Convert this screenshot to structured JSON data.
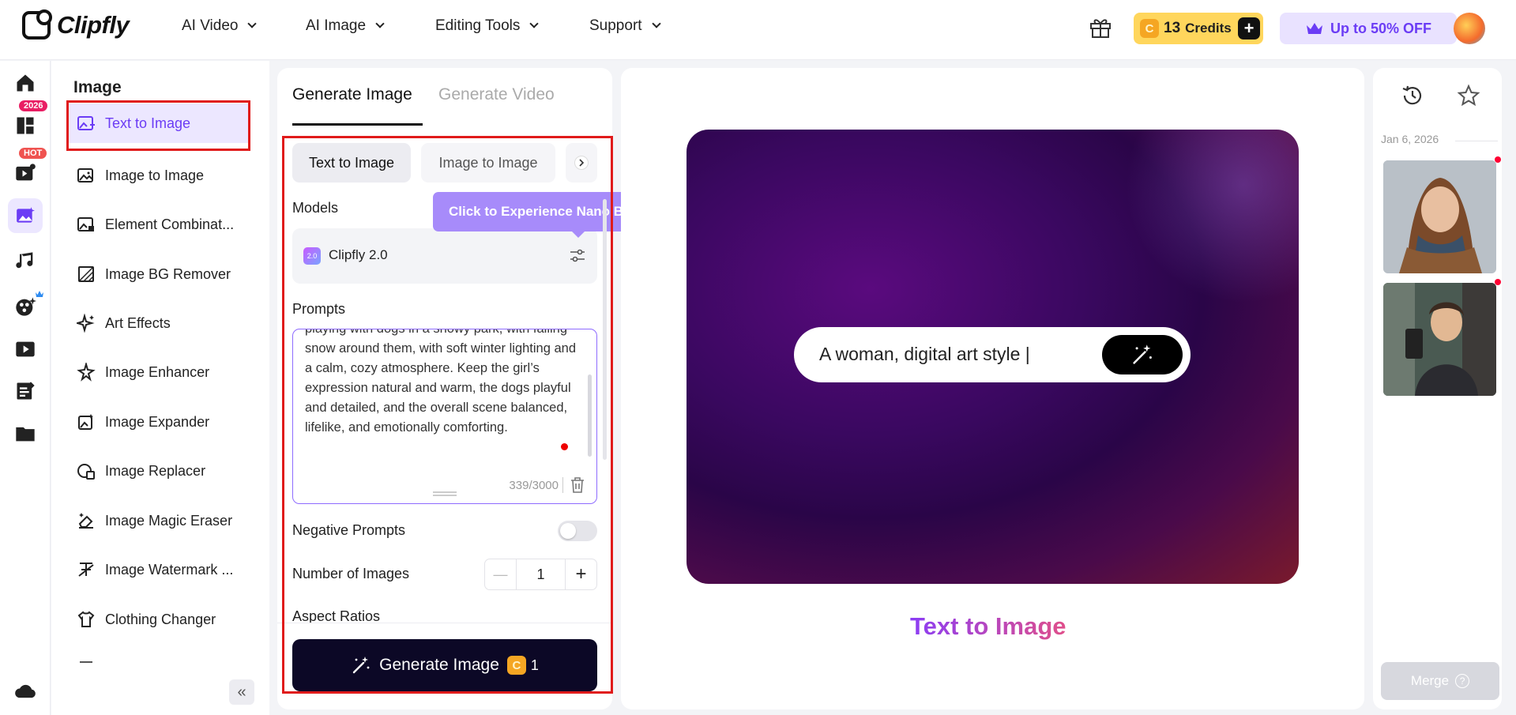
{
  "brand": {
    "name": "Clipfly"
  },
  "nav": {
    "items": [
      {
        "label": "AI Video"
      },
      {
        "label": "AI Image"
      },
      {
        "label": "Editing Tools"
      },
      {
        "label": "Support"
      }
    ],
    "credits": {
      "amount": "13",
      "label": "Credits",
      "coin": "C",
      "plus": "+"
    },
    "offer": "Up to 50% OFF"
  },
  "rail": {
    "badges": {
      "new_year": "2026",
      "hot": "HOT"
    }
  },
  "tools": {
    "title": "Image",
    "items": [
      {
        "label": "Text to Image"
      },
      {
        "label": "Image to Image"
      },
      {
        "label": "Element Combinat..."
      },
      {
        "label": "Image BG Remover"
      },
      {
        "label": "Art Effects"
      },
      {
        "label": "Image Enhancer"
      },
      {
        "label": "Image Expander"
      },
      {
        "label": "Image Replacer"
      },
      {
        "label": "Image Magic Eraser"
      },
      {
        "label": "Image Watermark ..."
      },
      {
        "label": "Clothing Changer"
      }
    ],
    "collapse": "«"
  },
  "panel": {
    "tabs": [
      {
        "label": "Generate Image"
      },
      {
        "label": "Generate Video"
      }
    ],
    "subtabs": [
      {
        "label": "Text to Image"
      },
      {
        "label": "Image to Image"
      }
    ],
    "models_label": "Models",
    "model": {
      "badge": "2.0",
      "name": "Clipfly 2.0"
    },
    "tooltip": "Click to Experience Nano Banana Pro",
    "prompts_label": "Prompts",
    "prompt_text": "playing with dogs in a snowy park, with falling snow around them, with soft winter lighting and a calm, cozy atmosphere. Keep the girl’s expression natural and warm, the dogs playful and detailed, and the overall scene balanced, lifelike, and emotionally comforting.",
    "prompt_count": "339/3000",
    "negative_label": "Negative Prompts",
    "negative_enabled": false,
    "count_label": "Number of Images",
    "count_minus": "—",
    "count_value": "1",
    "count_plus": "+",
    "aspect_label": "Aspect Ratios",
    "generate_label": "Generate Image",
    "generate_cost": "1",
    "generate_coin": "C"
  },
  "preview": {
    "search_text": "A woman, digital art style |",
    "title": "Text to Image"
  },
  "history": {
    "date": "Jan 6, 2026",
    "merge_label": "Merge",
    "merge_help": "?"
  },
  "colors": {
    "accent": "#6b3cf5",
    "highlight_border": "#e01b1b",
    "generate_bg": "#0c0826",
    "credits_bg": "#ffd65c"
  }
}
